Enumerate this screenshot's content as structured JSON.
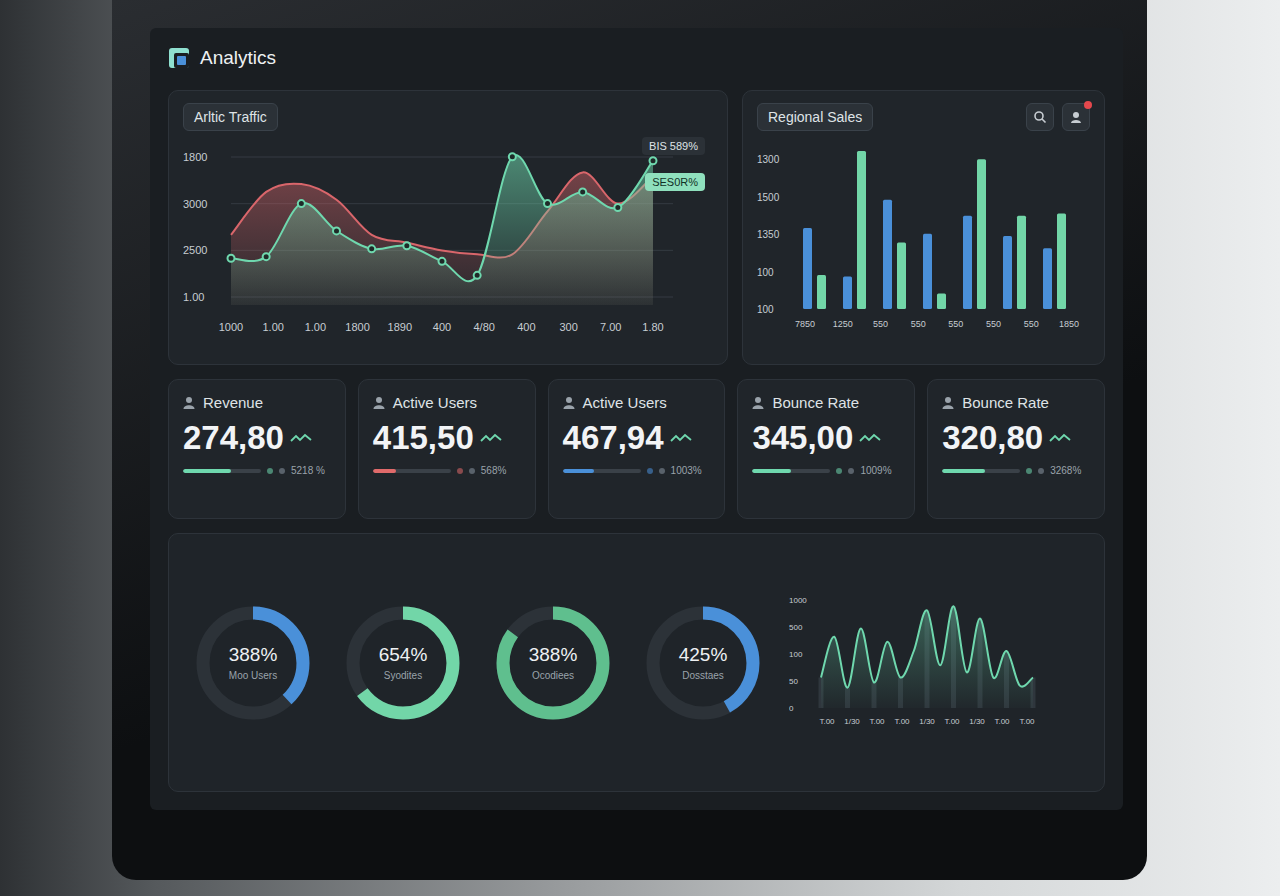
{
  "app": {
    "title": "Analytics"
  },
  "traffic_chart": {
    "title": "Arltic Traffic",
    "y_ticks": [
      "1800",
      "3000",
      "2500",
      "1.00"
    ],
    "x_ticks": [
      "1000",
      "1.00",
      "1.00",
      "1800",
      "1890",
      "400",
      "4/80",
      "400",
      "300",
      "7.00",
      "1.80"
    ],
    "badges": [
      {
        "text": "BIS 589%",
        "color": "#2b3137"
      },
      {
        "text": "SES0R%",
        "color": "#8fe0bd"
      }
    ],
    "series": [
      {
        "name": "red",
        "color": "#d9666b",
        "points": false,
        "values": [
          900,
          1450,
          1550,
          1350,
          900,
          800,
          700,
          650,
          650,
          1200,
          1700,
          1300,
          1650
        ]
      },
      {
        "name": "green",
        "color": "#6fd8ae",
        "points": true,
        "values": [
          600,
          620,
          1300,
          950,
          720,
          760,
          560,
          380,
          1900,
          1300,
          1450,
          1250,
          1850
        ]
      }
    ]
  },
  "regional_sales": {
    "title": "Regional Sales",
    "y_ticks": [
      "1300",
      "1500",
      "1350",
      "100",
      "100"
    ],
    "x_ticks": [
      "7850",
      "1250",
      "550",
      "550",
      "550",
      "550",
      "550",
      "1850"
    ],
    "series": [
      {
        "name": "blue",
        "color": "#4a90d9",
        "values": [
          1000,
          400,
          1350,
          930,
          1150,
          900,
          750
        ]
      },
      {
        "name": "green",
        "color": "#72d6a8",
        "values": [
          420,
          1950,
          820,
          190,
          1850,
          1150,
          1180
        ]
      }
    ]
  },
  "notifications": {
    "unread": true
  },
  "cards": [
    {
      "label": "Revenue",
      "value": "274,80",
      "change": "5218 %",
      "level": 0.62,
      "color": "#6fd8ae"
    },
    {
      "label": "Active Users",
      "value": "415,50",
      "change": "568%",
      "level": 0.3,
      "color": "#e06a6a"
    },
    {
      "label": "Active Users",
      "value": "467,94",
      "change": "1003%",
      "level": 0.4,
      "color": "#4a90d9"
    },
    {
      "label": "Bounce Rate",
      "value": "345,00",
      "change": "1009%",
      "level": 0.5,
      "color": "#6fd8ae"
    },
    {
      "label": "Bounce Rate",
      "value": "320,80",
      "change": "3268%",
      "level": 0.55,
      "color": "#6fd8ae"
    }
  ],
  "donuts": [
    {
      "value": "388%",
      "caption": "Moo Users",
      "level": 0.38,
      "color": "#4a90d9"
    },
    {
      "value": "654%",
      "caption": "Syodites",
      "level": 0.65,
      "color": "#72d6a8"
    },
    {
      "value": "388%",
      "caption": "Ocodiees",
      "level": 0.85,
      "color": "#5fbf8e"
    },
    {
      "value": "425%",
      "caption": "Dosstaes",
      "level": 0.42,
      "color": "#4a90d9"
    }
  ],
  "wave_chart": {
    "y_ticks": [
      "1000",
      "500",
      "100",
      "50",
      "0"
    ],
    "x_ticks": [
      "T.00",
      "1/30",
      "T.00",
      "T.00",
      "1/30",
      "T.00",
      "1/30",
      "T.00",
      "T.00"
    ],
    "color": "#6fd8ae",
    "values": [
      300,
      700,
      200,
      780,
      250,
      650,
      300,
      560,
      960,
      420,
      1000,
      350,
      880,
      300,
      560,
      220,
      300
    ]
  }
}
